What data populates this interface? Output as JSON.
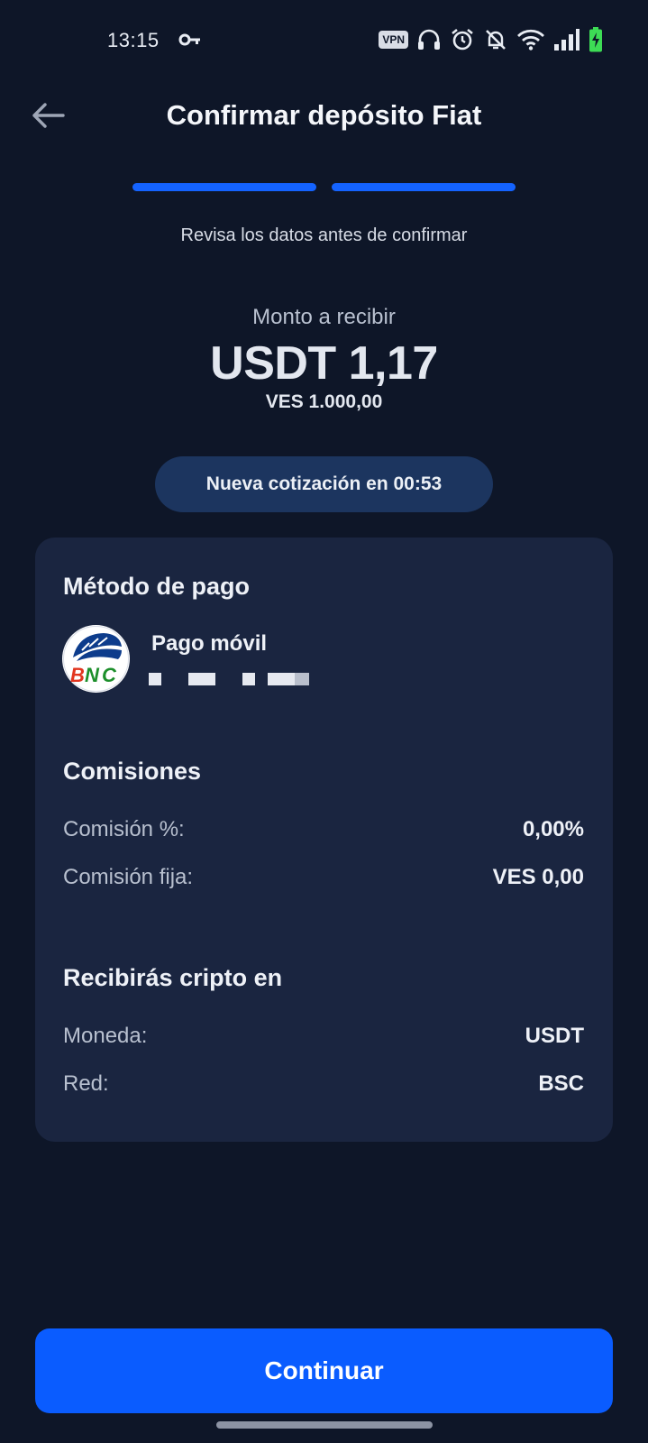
{
  "status_bar": {
    "time": "13:15",
    "vpn_label": "VPN",
    "icons": [
      "key-icon",
      "vpn-icon",
      "headphones-icon",
      "alarm-icon",
      "bell-off-icon",
      "wifi-icon",
      "signal-icon",
      "battery-charging-icon"
    ]
  },
  "header": {
    "title": "Confirmar depósito Fiat",
    "back_icon": "arrow-left-icon"
  },
  "progress": {
    "steps_total": 2,
    "steps_completed": 2,
    "color": "#1463ff"
  },
  "subtitle": "Revisa los datos antes de confirmar",
  "amount": {
    "label": "Monto a recibir",
    "value": "USDT 1,17",
    "fiat": "VES 1.000,00"
  },
  "quote": {
    "text": "Nueva cotización en 00:53"
  },
  "payment_method": {
    "title": "Método de pago",
    "name": "Pago móvil",
    "bank_logo": "BNC"
  },
  "fees": {
    "title": "Comisiones",
    "rows": [
      {
        "label": "Comisión %:",
        "value": "0,00%"
      },
      {
        "label": "Comisión fija:",
        "value": "VES 0,00"
      }
    ]
  },
  "receive": {
    "title": "Recibirás cripto en",
    "rows": [
      {
        "label": "Moneda:",
        "value": "USDT"
      },
      {
        "label": "Red:",
        "value": "BSC"
      }
    ]
  },
  "actions": {
    "continue_label": "Continuar"
  },
  "colors": {
    "background": "#0e1628",
    "card": "#1a2540",
    "accent": "#0a5cff",
    "pill": "#1c355f"
  }
}
